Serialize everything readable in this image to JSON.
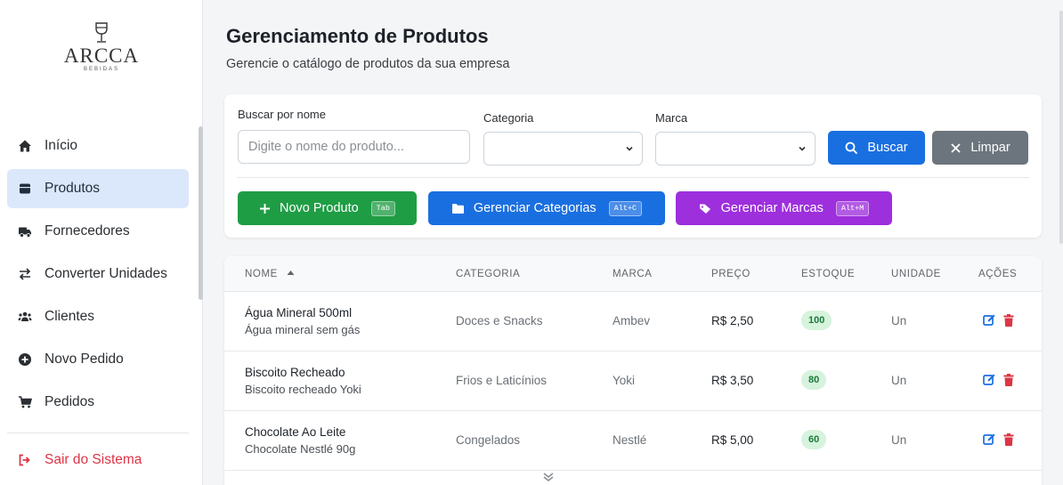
{
  "brand": {
    "name": "ARCCA",
    "sub": "BEBIDAS"
  },
  "sidebar": {
    "items": [
      {
        "label": "Início",
        "icon": "home-icon",
        "active": false
      },
      {
        "label": "Produtos",
        "icon": "box-icon",
        "active": true
      },
      {
        "label": "Fornecedores",
        "icon": "truck-icon",
        "active": false
      },
      {
        "label": "Converter Unidades",
        "icon": "exchange-icon",
        "active": false
      },
      {
        "label": "Clientes",
        "icon": "users-icon",
        "active": false
      },
      {
        "label": "Novo Pedido",
        "icon": "plus-circle-icon",
        "active": false
      },
      {
        "label": "Pedidos",
        "icon": "cart-icon",
        "active": false
      }
    ],
    "logout": "Sair do Sistema"
  },
  "header": {
    "title": "Gerenciamento de Produtos",
    "subtitle": "Gerencie o catálogo de produtos da sua empresa"
  },
  "filters": {
    "name_label": "Buscar por nome",
    "name_placeholder": "Digite o nome do produto...",
    "name_value": "",
    "category_label": "Categoria",
    "category_value": "",
    "brand_label": "Marca",
    "brand_value": "",
    "search_label": "Buscar",
    "clear_label": "Limpar"
  },
  "actions": {
    "new_product": {
      "label": "Novo Produto",
      "shortcut": "Tab"
    },
    "manage_categories": {
      "label": "Gerenciar Categorias",
      "shortcut": "Alt+C"
    },
    "manage_brands": {
      "label": "Gerenciar Marcas",
      "shortcut": "Alt+M"
    }
  },
  "table": {
    "columns": [
      "NOME",
      "CATEGORIA",
      "MARCA",
      "PREÇO",
      "ESTOQUE",
      "UNIDADE",
      "AÇÕES"
    ],
    "sort_column": "NOME",
    "sort_direction": "asc",
    "rows": [
      {
        "name": "Água Mineral 500ml",
        "description": "Água mineral sem gás",
        "category": "Doces e Snacks",
        "brand": "Ambev",
        "price": "R$ 2,50",
        "stock": "100",
        "unit": "Un"
      },
      {
        "name": "Biscoito Recheado",
        "description": "Biscoito recheado Yoki",
        "category": "Frios e Laticínios",
        "brand": "Yoki",
        "price": "R$ 3,50",
        "stock": "80",
        "unit": "Un"
      },
      {
        "name": "Chocolate Ao Leite",
        "description": "Chocolate Nestlé 90g",
        "category": "Congelados",
        "brand": "Nestlé",
        "price": "R$ 5,00",
        "stock": "60",
        "unit": "Un"
      }
    ]
  },
  "colors": {
    "active_nav": "#dbe8fb",
    "primary": "#1a6fe0",
    "success": "#1f9d45",
    "purple": "#9d2fdc",
    "secondary": "#6c757d",
    "danger": "#dc3545",
    "stock_badge_bg": "#d6f3dd"
  }
}
